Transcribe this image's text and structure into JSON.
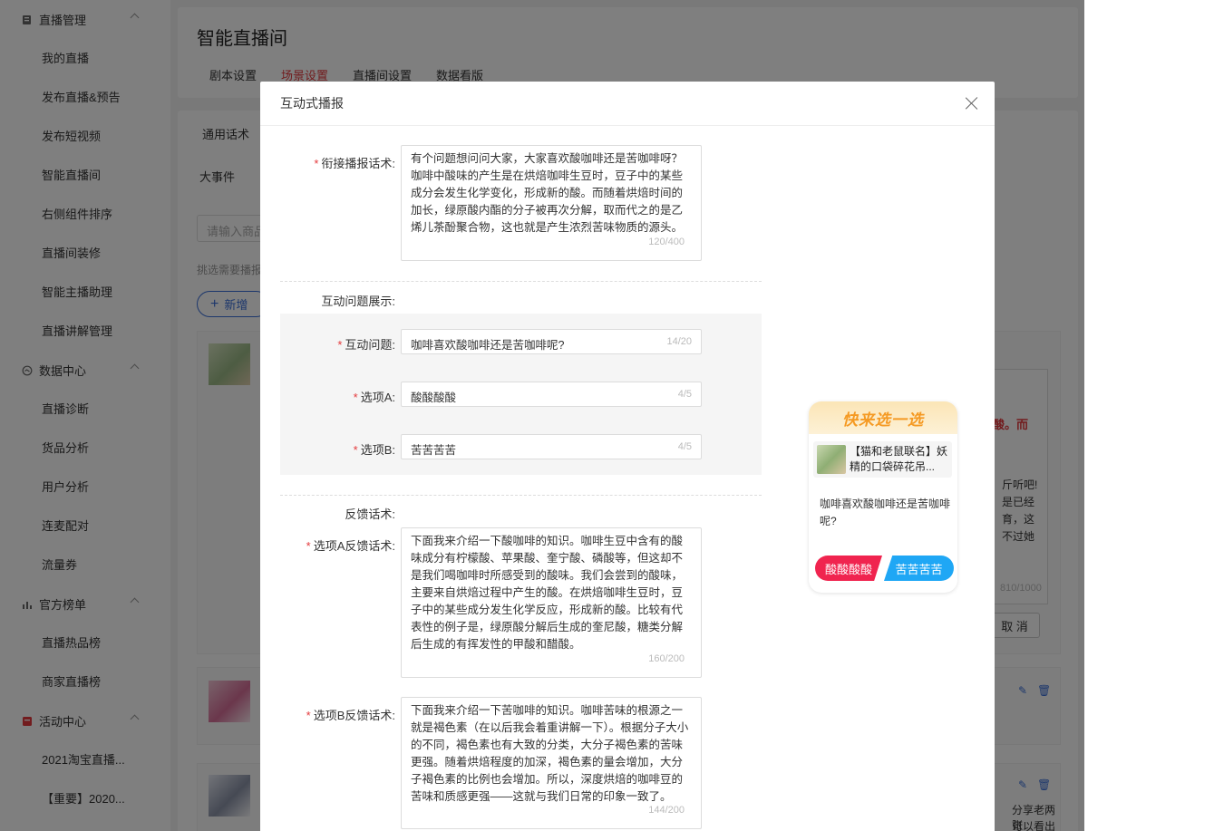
{
  "sidebar": {
    "groups": [
      {
        "title": "直播管理",
        "icon": "live-icon",
        "items": [
          "我的直播",
          "发布直播&预告",
          "发布短视频",
          "智能直播间",
          "右侧组件排序",
          "直播间装修",
          "智能主播助理",
          "直播讲解管理"
        ]
      },
      {
        "title": "数据中心",
        "icon": "data-icon",
        "items": [
          "直播诊断",
          "货品分析",
          "用户分析",
          "连麦配对",
          "流量券"
        ]
      },
      {
        "title": "官方榜单",
        "icon": "chart-icon",
        "items": [
          "直播热品榜",
          "商家直播榜"
        ]
      },
      {
        "title": "活动中心",
        "icon": "activity-icon",
        "items": [
          "2021淘宝直播...",
          "【重要】2020..."
        ]
      }
    ]
  },
  "page": {
    "title": "智能直播间",
    "tabs": [
      "剧本设置",
      "场景设置",
      "直播间设置",
      "数据看版"
    ],
    "active_tab": "场景设置",
    "sub_tab": "通用话术",
    "sub_tab2": "大事件",
    "search_placeholder": "请输入商品",
    "hint": "挑选需要播报",
    "add_label": "新增",
    "cancel_label": "取 消",
    "peek_text_1": "酸。而",
    "peek_text_2": "斤听吧!",
    "peek_text_3": "是已经",
    "peek_text_4": "育，这",
    "peek_text_5": "不过她",
    "peek_counter": "810/1000",
    "peek_text_6": "分享老两张",
    "peek_text_7": "可以看出一"
  },
  "modal": {
    "title": "互动式播报",
    "bridge_label": "衔接播报话术:",
    "bridge_text": "有个问题想问问大家，大家喜欢酸咖啡还是苦咖啡呀？咖啡中酸味的产生是在烘焙咖啡生豆时，豆子中的某些成分会发生化学变化，形成新的酸。而随着烘焙时间的加长，绿原酸内酯的分子被再次分解，取而代之的是乙烯儿茶酚聚合物，这也就是产生浓烈苦味物质的源头。",
    "bridge_count": "120/400",
    "question_section": "互动问题展示:",
    "question_label": "互动问题:",
    "question_value": "咖啡喜欢酸咖啡还是苦咖啡呢?",
    "question_count": "14/20",
    "optionA_label": "选项A:",
    "optionA_value": "酸酸酸酸",
    "optionA_count": "4/5",
    "optionB_label": "选项B:",
    "optionB_value": "苦苦苦苦",
    "optionB_count": "4/5",
    "feedback_section": "反馈话术:",
    "feedbackA_label": "选项A反馈话术:",
    "feedbackA_text": "下面我来介绍一下酸咖啡的知识。咖啡生豆中含有的酸味成分有柠檬酸、苹果酸、奎宁酸、磷酸等，但这却不是我们喝咖啡时所感受到的酸味。我们会尝到的酸味，主要来自烘焙过程中产生的酸。在烘焙咖啡生豆时，豆子中的某些成分发生化学反应，形成新的酸。比较有代表性的例子是，绿原酸分解后生成的奎尼酸，糖类分解后生成的有挥发性的甲酸和醋酸。",
    "feedbackA_count": "160/200",
    "feedbackB_label": "选项B反馈话术:",
    "feedbackB_text": "下面我来介绍一下苦咖啡的知识。咖啡苦味的根源之一就是褐色素（在以后我会着重讲解一下）。根据分子大小的不同，褐色素也有大致的分类，大分子褐色素的苦味更强。随着烘焙程度的加深，褐色素的量会增加，大分子褐色素的比例也会增加。所以，深度烘焙的咖啡豆的苦味和质感更强——这就与我们日常的印象一致了。",
    "feedbackB_count": "144/200"
  },
  "preview": {
    "header": "快来选一选",
    "product_name": "【猫和老鼠联名】妖精的口袋碎花吊...",
    "question": "咖啡喜欢酸咖啡还是苦咖啡呢?",
    "optionA": "酸酸酸酸",
    "optionB": "苦苦苦苦"
  },
  "colors": {
    "accent": "#e4393c",
    "blue": "#3a6fd8",
    "optionA": "#f0244f",
    "optionB": "#1fa7f5"
  }
}
